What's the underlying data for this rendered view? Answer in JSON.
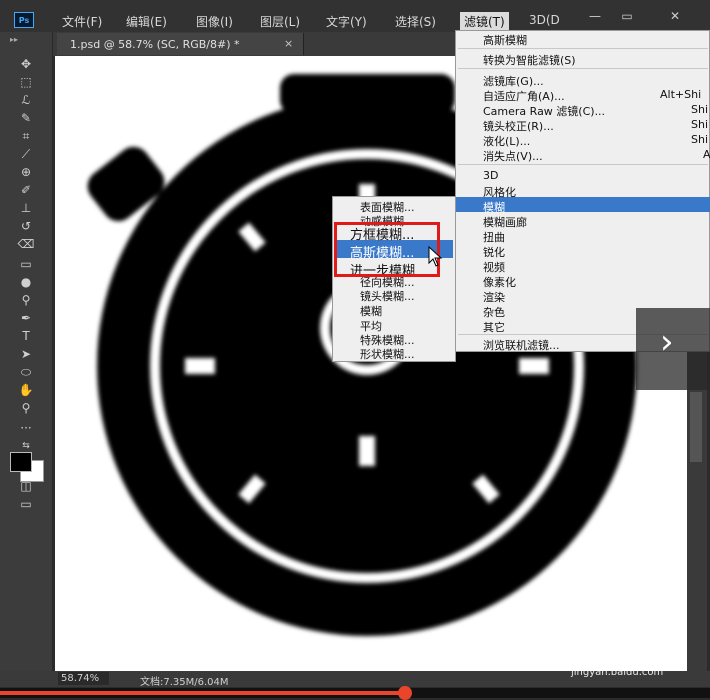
{
  "app": {
    "logo": "Ps"
  },
  "menubar": {
    "items": [
      "文件(F)",
      "编辑(E)",
      "图像(I)",
      "图层(L)",
      "文字(Y)",
      "选择(S)",
      "滤镜(T)",
      "3D(D"
    ],
    "active_item": "滤镜(T)",
    "window_buttons": {
      "minimize": "—",
      "restore": "▭",
      "close": "✕"
    }
  },
  "document_tab": {
    "title": "1.psd @ 58.7% (SC, RGB/8#) *",
    "close": "×"
  },
  "status": {
    "zoom": "58.74%",
    "doc_size": "文档:7.35M/6.04M"
  },
  "filter_menu": {
    "last_filter": "高斯模糊",
    "convert_smart": "转换为智能滤镜(S)",
    "group1": [
      {
        "label": "滤镜库(G)...",
        "shortcut": ""
      },
      {
        "label": "自适应广角(A)...",
        "shortcut": "Alt+Shi"
      },
      {
        "label": "Camera Raw 滤镜(C)...",
        "shortcut": "Shi"
      },
      {
        "label": "镜头校正(R)...",
        "shortcut": "Shi"
      },
      {
        "label": "液化(L)...",
        "shortcut": "Shi"
      },
      {
        "label": "消失点(V)...",
        "shortcut": "A"
      }
    ],
    "group2": [
      "3D",
      "风格化",
      "模糊",
      "模糊画廊",
      "扭曲",
      "锐化",
      "视频",
      "像素化",
      "渲染",
      "杂色",
      "其它"
    ],
    "highlighted": "模糊",
    "browse": "浏览联机滤镜..."
  },
  "blur_submenu": {
    "items": [
      "表面模糊...",
      "动感模糊...",
      "方框模糊...",
      "高斯模糊...",
      "进一步模糊",
      "径向模糊...",
      "镜头模糊...",
      "模糊",
      "平均",
      "特殊模糊...",
      "形状模糊..."
    ],
    "highlighted": "高斯模糊..."
  },
  "video": {
    "next": "›",
    "progress": 0.57
  },
  "watermark": {
    "brand": "Bai度经验",
    "url": "jingyan.baidu.com"
  },
  "colors": {
    "accent": "#3a78c9",
    "annotation": "#e01919",
    "progress": "#e8452b"
  }
}
